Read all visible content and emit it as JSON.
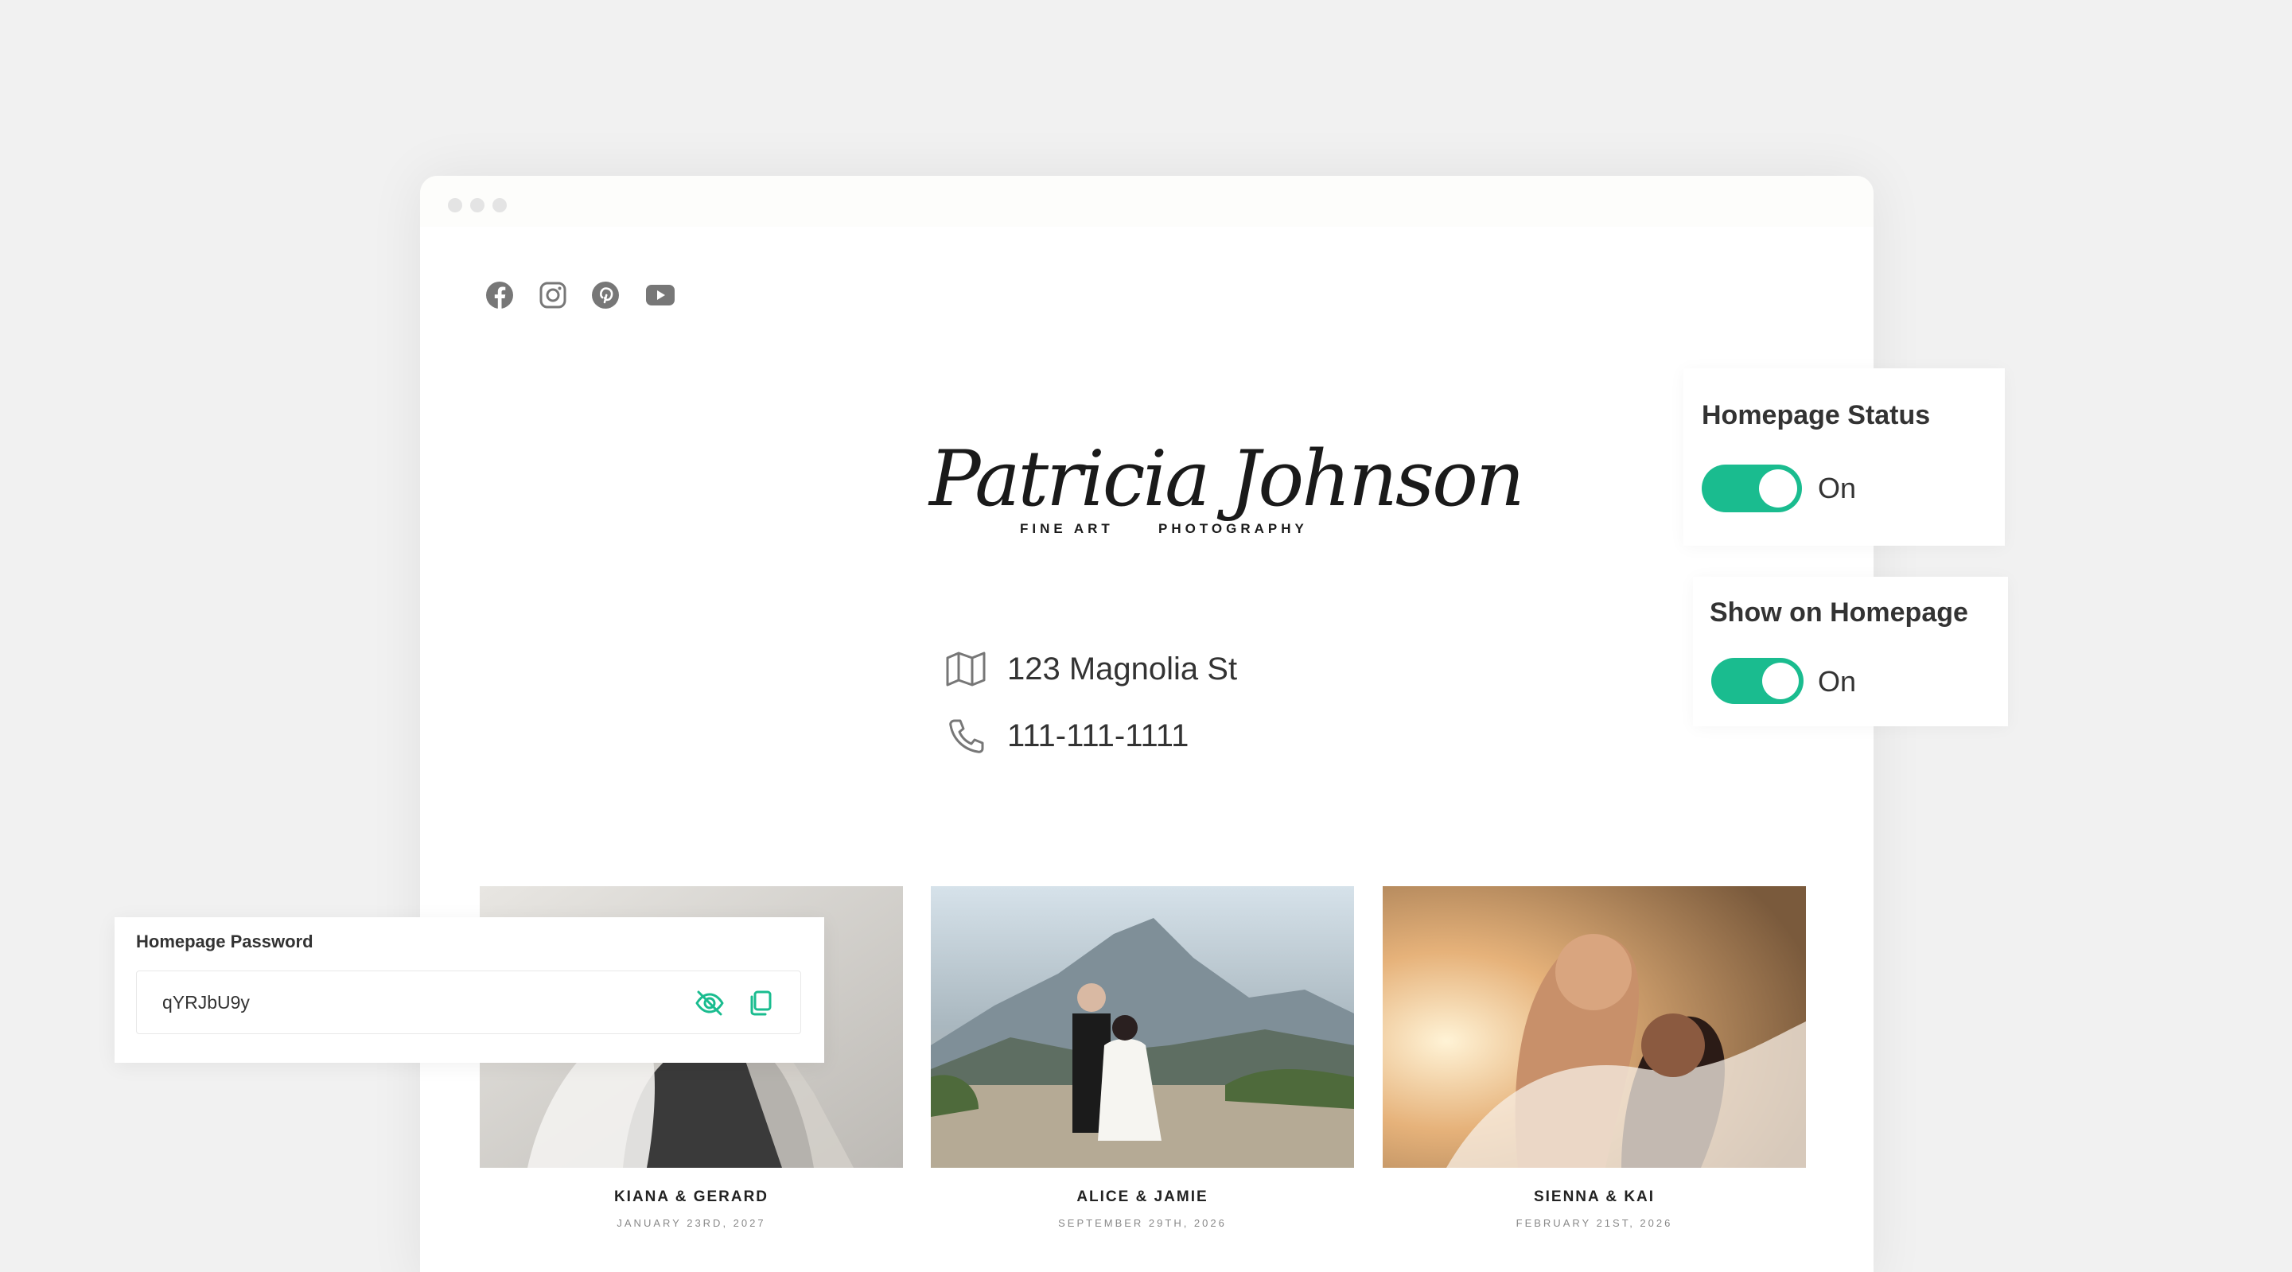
{
  "logo": {
    "script": "Patricia Johnson",
    "left_word": "FINE ART",
    "right_word": "PHOTOGRAPHY"
  },
  "social": [
    "facebook-icon",
    "instagram-icon",
    "pinterest-icon",
    "youtube-icon"
  ],
  "contact": {
    "address": "123 Magnolia St",
    "phone": "111-111-1111"
  },
  "gallery": [
    {
      "title": "KIANA & GERARD",
      "date": "JANUARY 23RD, 2027"
    },
    {
      "title": "ALICE & JAMIE",
      "date": "SEPTEMBER 29TH, 2026"
    },
    {
      "title": "SIENNA & KAI",
      "date": "FEBRUARY 21ST, 2026"
    }
  ],
  "homepage_status": {
    "title": "Homepage Status",
    "state": "On"
  },
  "show_on_homepage": {
    "title": "Show on Homepage",
    "state": "On"
  },
  "password": {
    "title": "Homepage Password",
    "value": "qYRJbU9y"
  },
  "colors": {
    "accent": "#1abc8f",
    "background": "#f1f1f1",
    "icon": "#777777"
  }
}
